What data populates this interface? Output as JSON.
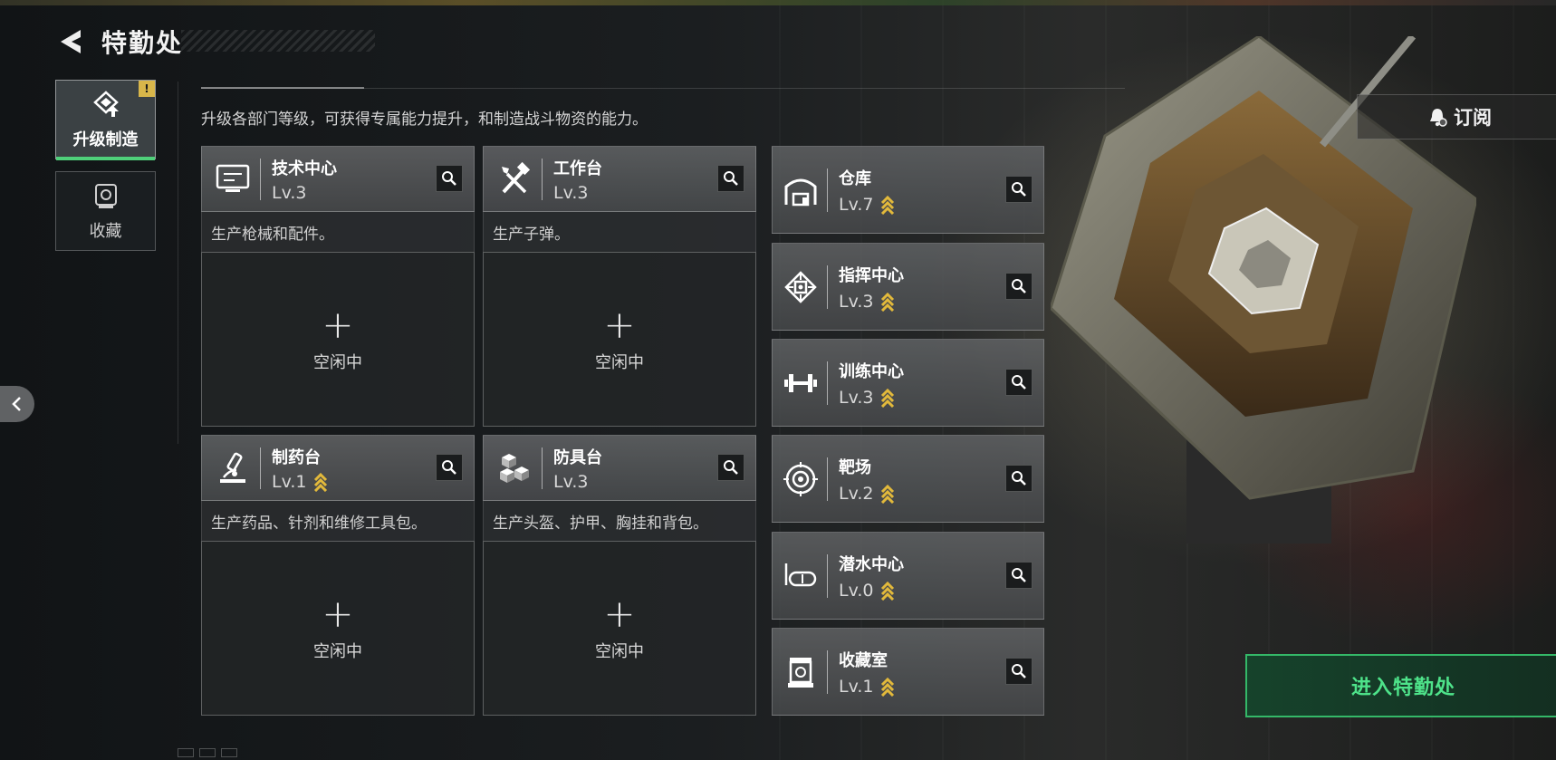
{
  "header": {
    "title": "特勤处",
    "back_icon": "back-arrow-icon"
  },
  "tabs": [
    {
      "label": "升级制造",
      "icon": "upgrade-icon",
      "active": true,
      "badge": "!"
    },
    {
      "label": "收藏",
      "icon": "collection-icon",
      "active": false
    }
  ],
  "description": "升级各部门等级，可获得专属能力提升，和制造战斗物资的能力。",
  "subscribe": {
    "label": "订阅",
    "icon": "bell-icon"
  },
  "production": [
    {
      "name": "技术中心",
      "level": "Lv.3",
      "upgradable": false,
      "icon": "monitor-icon",
      "desc": "生产枪械和配件。",
      "slot_label": "空闲中",
      "slot_plus": "+"
    },
    {
      "name": "工作台",
      "level": "Lv.3",
      "upgradable": false,
      "icon": "tools-icon",
      "desc": "生产子弹。",
      "slot_label": "空闲中",
      "slot_plus": "+"
    },
    {
      "name": "制药台",
      "level": "Lv.1",
      "upgradable": true,
      "icon": "microscope-icon",
      "desc": "生产药品、针剂和维修工具包。",
      "slot_label": "空闲中",
      "slot_plus": "+"
    },
    {
      "name": "防具台",
      "level": "Lv.3",
      "upgradable": false,
      "icon": "armor-blocks-icon",
      "desc": "生产头盔、护甲、胸挂和背包。",
      "slot_label": "空闲中",
      "slot_plus": "+"
    }
  ],
  "departments": [
    {
      "name": "仓库",
      "level": "Lv.7",
      "upgradable": true,
      "icon": "warehouse-icon"
    },
    {
      "name": "指挥中心",
      "level": "Lv.3",
      "upgradable": true,
      "icon": "chip-icon"
    },
    {
      "name": "训练中心",
      "level": "Lv.3",
      "upgradable": true,
      "icon": "dumbbell-icon"
    },
    {
      "name": "靶场",
      "level": "Lv.2",
      "upgradable": true,
      "icon": "target-icon"
    },
    {
      "name": "潜水中心",
      "level": "Lv.0",
      "upgradable": true,
      "icon": "diving-mask-icon"
    },
    {
      "name": "收藏室",
      "level": "Lv.1",
      "upgradable": true,
      "icon": "display-case-icon"
    }
  ],
  "enter_button": {
    "label": "进入特勤处"
  },
  "colors": {
    "accent_green": "#4ee38a",
    "upgrade_gold": "#e2b93b",
    "badge_gold": "#d8b64a"
  }
}
